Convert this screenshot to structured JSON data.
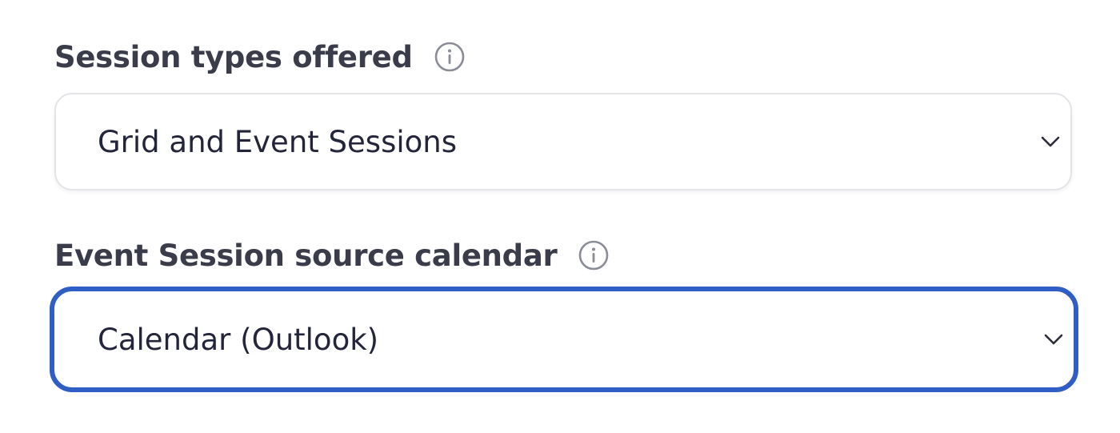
{
  "session_types": {
    "label": "Session types offered",
    "selected": "Grid and Event Sessions"
  },
  "source_calendar": {
    "label": "Event Session source calendar",
    "selected": "Calendar (Outlook)"
  },
  "colors": {
    "focus_border": "#2f5fc4",
    "text": "#23253a",
    "icon": "#8a8c96"
  }
}
